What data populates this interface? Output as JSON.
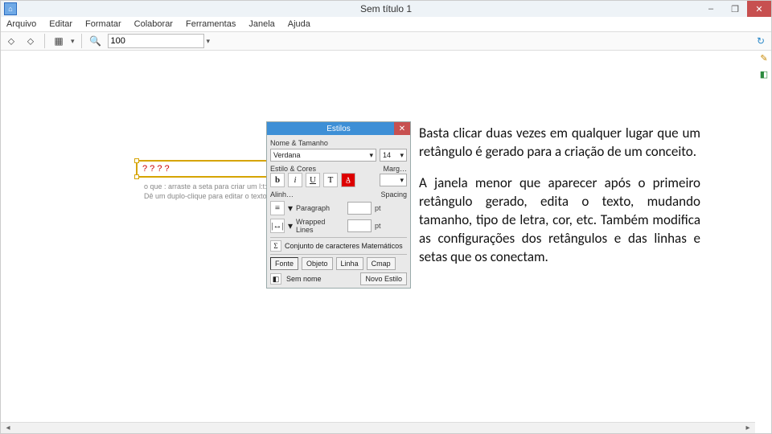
{
  "window": {
    "title": "Sem título 1",
    "minimize": "–",
    "maximize": "❐",
    "close": "✕"
  },
  "menu": {
    "items": [
      "Arquivo",
      "Editar",
      "Formatar",
      "Colaborar",
      "Ferramentas",
      "Janela",
      "Ajuda"
    ]
  },
  "toolbar": {
    "zoom_value": "100",
    "zoom_caret": "▾"
  },
  "concept": {
    "text": "? ? ? ?",
    "hint_line1": "o que : arraste a seta para criar um l:t:",
    "hint_line2": "Dê um duplo-clique para editar o texto"
  },
  "dialog": {
    "title": "Estilos",
    "close": "✕",
    "sections": {
      "name_size": "Nome & Tamanho",
      "font_value": "Verdana",
      "size_value": "14",
      "style_color": "Estilo & Cores",
      "margin_label": "Marg…",
      "bold": "b",
      "italic": "i",
      "underline": "U",
      "text_icon": "T",
      "aa_icon": "A̲",
      "align_section": "Alinh…",
      "spacing_section": "Spacing",
      "para_label": "Paragraph",
      "wrap_label": "Wrapped Lines",
      "unit": "pt",
      "math_set": "Conjunto de caracteres Matemáticos",
      "tabs": [
        "Fonte",
        "Objeto",
        "Linha",
        "Cmap"
      ],
      "name_lbl": "Sem nome",
      "new_style_btn": "Novo Estilo"
    }
  },
  "body": {
    "p1": "Basta clicar duas vezes em qualquer lugar que um retângulo é gerado para a criação de um conceito.",
    "p2": "A janela menor que aparecer após o primeiro retângulo gerado, edita o texto, mudando tamanho, tipo de letra, cor, etc. Também modifica as configurações dos retângulos e  das linhas e setas que os conectam."
  },
  "colors": {
    "accent": "#3d8fd6",
    "close_red": "#c75050"
  }
}
